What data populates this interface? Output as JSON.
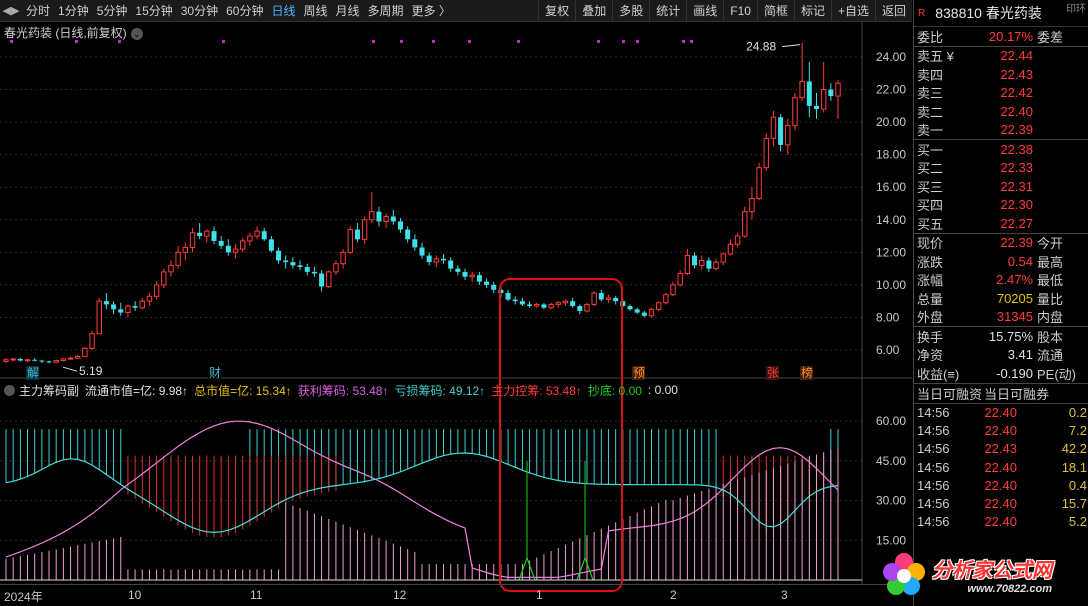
{
  "toolbar": {
    "periods": [
      "分时",
      "1分钟",
      "5分钟",
      "15分钟",
      "30分钟",
      "60分钟",
      "日线",
      "周线",
      "月线",
      "多周期",
      "更多 〉"
    ],
    "active_period": "日线",
    "right_items": [
      "复权",
      "叠加",
      "多股",
      "统计",
      "画线",
      "F10",
      "简框",
      "标记",
      "+自选",
      "返回"
    ]
  },
  "chart": {
    "title": "春光药装 (日线,前复权)",
    "y_labels": [
      "24.00",
      "22.00",
      "20.00",
      "18.00",
      "16.00",
      "14.00",
      "12.00",
      "10.00",
      "8.00",
      "6.00"
    ],
    "high_label": "24.88",
    "low_label": "5.19",
    "event_tags": [
      {
        "text": "解",
        "color": "#3fb8d0",
        "bg": "#0d3040"
      },
      {
        "text": "财",
        "color": "#3fb8d0",
        "bg": "#000"
      },
      {
        "text": "预",
        "color": "#ff9020",
        "bg": "#402010"
      },
      {
        "text": "张",
        "color": "#ff3b3b",
        "bg": "#401010"
      },
      {
        "text": "榜",
        "color": "#ff9020",
        "bg": "#402010"
      }
    ]
  },
  "chart_data": {
    "type": "candlestick",
    "y_axis": [
      6.0,
      24.0
    ],
    "x_months": [
      "2024年",
      "10",
      "11",
      "12",
      "1",
      "2",
      "3"
    ],
    "ohlc": [
      [
        5.3,
        5.5,
        5.2,
        5.4
      ],
      [
        5.4,
        5.5,
        5.3,
        5.45
      ],
      [
        5.45,
        5.5,
        5.3,
        5.35
      ],
      [
        5.35,
        5.45,
        5.25,
        5.4
      ],
      [
        5.4,
        5.5,
        5.3,
        5.35
      ],
      [
        5.35,
        5.4,
        5.2,
        5.3
      ],
      [
        5.3,
        5.35,
        5.19,
        5.25
      ],
      [
        5.25,
        5.4,
        5.2,
        5.35
      ],
      [
        5.35,
        5.5,
        5.3,
        5.45
      ],
      [
        5.45,
        5.6,
        5.4,
        5.5
      ],
      [
        5.5,
        5.7,
        5.45,
        5.6
      ],
      [
        5.6,
        6.2,
        5.6,
        6.1
      ],
      [
        6.1,
        7.2,
        6.0,
        7.0
      ],
      [
        7.0,
        9.2,
        7.0,
        9.0
      ],
      [
        9.0,
        9.5,
        8.5,
        8.8
      ],
      [
        8.8,
        9.0,
        8.2,
        8.5
      ],
      [
        8.5,
        8.9,
        8.1,
        8.3
      ],
      [
        8.3,
        8.8,
        8.0,
        8.7
      ],
      [
        8.7,
        9.0,
        8.4,
        8.6
      ],
      [
        8.6,
        9.2,
        8.5,
        9.0
      ],
      [
        9.0,
        9.5,
        8.7,
        9.3
      ],
      [
        9.3,
        10.2,
        9.1,
        10.0
      ],
      [
        10.0,
        11.0,
        9.8,
        10.8
      ],
      [
        10.8,
        11.5,
        10.5,
        11.2
      ],
      [
        11.2,
        12.4,
        11.0,
        12.0
      ],
      [
        12.0,
        12.6,
        11.5,
        12.3
      ],
      [
        12.3,
        13.5,
        12.0,
        13.2
      ],
      [
        13.2,
        13.8,
        12.8,
        13.0
      ],
      [
        13.0,
        13.4,
        12.6,
        13.3
      ],
      [
        13.3,
        13.6,
        12.5,
        12.7
      ],
      [
        12.7,
        13.0,
        12.2,
        12.4
      ],
      [
        12.4,
        12.8,
        11.8,
        12.0
      ],
      [
        12.0,
        12.5,
        11.6,
        12.2
      ],
      [
        12.2,
        12.9,
        12.0,
        12.7
      ],
      [
        12.7,
        13.2,
        12.4,
        13.0
      ],
      [
        13.0,
        13.6,
        12.8,
        13.3
      ],
      [
        13.3,
        13.5,
        12.7,
        12.8
      ],
      [
        12.8,
        13.0,
        12.0,
        12.1
      ],
      [
        12.1,
        12.3,
        11.3,
        11.5
      ],
      [
        11.5,
        11.8,
        11.0,
        11.4
      ],
      [
        11.4,
        11.7,
        11.0,
        11.2
      ],
      [
        11.2,
        11.5,
        10.9,
        11.1
      ],
      [
        11.1,
        11.3,
        10.6,
        10.8
      ],
      [
        10.8,
        11.1,
        10.5,
        10.7
      ],
      [
        10.7,
        10.9,
        9.6,
        9.9
      ],
      [
        9.9,
        10.9,
        9.8,
        10.8
      ],
      [
        10.8,
        11.5,
        10.6,
        11.3
      ],
      [
        11.3,
        12.2,
        11.0,
        12.0
      ],
      [
        12.0,
        13.6,
        11.9,
        13.4
      ],
      [
        13.4,
        13.8,
        12.6,
        12.8
      ],
      [
        12.8,
        14.2,
        12.5,
        14.0
      ],
      [
        14.0,
        15.7,
        13.8,
        14.5
      ],
      [
        14.5,
        14.8,
        13.6,
        13.9
      ],
      [
        13.9,
        14.4,
        13.5,
        14.2
      ],
      [
        14.2,
        14.6,
        13.7,
        13.9
      ],
      [
        13.9,
        14.1,
        13.2,
        13.4
      ],
      [
        13.4,
        13.6,
        12.6,
        12.8
      ],
      [
        12.8,
        13.1,
        12.1,
        12.3
      ],
      [
        12.3,
        12.6,
        11.6,
        11.8
      ],
      [
        11.8,
        12.0,
        11.2,
        11.4
      ],
      [
        11.4,
        11.8,
        11.1,
        11.6
      ],
      [
        11.6,
        11.9,
        11.3,
        11.5
      ],
      [
        11.5,
        11.7,
        10.8,
        11.0
      ],
      [
        11.0,
        11.2,
        10.6,
        10.8
      ],
      [
        10.8,
        11.0,
        10.3,
        10.5
      ],
      [
        10.5,
        10.8,
        10.2,
        10.6
      ],
      [
        10.6,
        10.8,
        10.0,
        10.2
      ],
      [
        10.2,
        10.4,
        9.8,
        10.0
      ],
      [
        10.0,
        10.2,
        9.5,
        9.7
      ],
      [
        9.7,
        9.9,
        9.2,
        9.5
      ],
      [
        9.5,
        9.7,
        9.0,
        9.1
      ],
      [
        9.1,
        9.3,
        8.8,
        9.0
      ],
      [
        9.0,
        9.2,
        8.7,
        8.8
      ],
      [
        8.8,
        9.0,
        8.6,
        8.7
      ],
      [
        8.7,
        8.9,
        8.6,
        8.8
      ],
      [
        8.8,
        8.9,
        8.5,
        8.6
      ],
      [
        8.6,
        8.9,
        8.5,
        8.8
      ],
      [
        8.8,
        9.0,
        8.6,
        8.9
      ],
      [
        8.9,
        9.1,
        8.7,
        9.0
      ],
      [
        9.0,
        9.2,
        8.6,
        8.7
      ],
      [
        8.7,
        8.8,
        8.2,
        8.4
      ],
      [
        8.4,
        8.9,
        8.3,
        8.8
      ],
      [
        8.8,
        9.6,
        8.7,
        9.5
      ],
      [
        9.5,
        9.7,
        9.0,
        9.1
      ],
      [
        9.1,
        9.4,
        8.9,
        9.2
      ],
      [
        9.2,
        9.3,
        8.8,
        9.0
      ],
      [
        9.0,
        9.1,
        8.6,
        8.7
      ],
      [
        8.7,
        8.8,
        8.4,
        8.5
      ],
      [
        8.5,
        8.6,
        8.2,
        8.3
      ],
      [
        8.3,
        8.4,
        8.0,
        8.1
      ],
      [
        8.1,
        8.6,
        8.0,
        8.5
      ],
      [
        8.5,
        9.0,
        8.4,
        8.9
      ],
      [
        8.9,
        9.5,
        8.8,
        9.4
      ],
      [
        9.4,
        10.2,
        9.3,
        10.0
      ],
      [
        10.0,
        10.9,
        9.9,
        10.7
      ],
      [
        10.7,
        12.2,
        10.6,
        11.8
      ],
      [
        11.8,
        12.0,
        11.0,
        11.2
      ],
      [
        11.2,
        11.8,
        10.9,
        11.5
      ],
      [
        11.5,
        11.7,
        10.8,
        11.0
      ],
      [
        11.0,
        11.6,
        10.9,
        11.4
      ],
      [
        11.4,
        12.0,
        11.2,
        11.9
      ],
      [
        11.9,
        12.8,
        11.8,
        12.5
      ],
      [
        12.5,
        13.2,
        12.3,
        13.0
      ],
      [
        13.0,
        14.8,
        12.9,
        14.5
      ],
      [
        14.5,
        16.0,
        14.0,
        15.3
      ],
      [
        15.3,
        17.5,
        15.2,
        17.2
      ],
      [
        17.2,
        19.3,
        17.0,
        19.0
      ],
      [
        19.0,
        20.7,
        18.5,
        20.3
      ],
      [
        20.3,
        20.5,
        18.2,
        18.6
      ],
      [
        18.6,
        20.2,
        18.0,
        19.8
      ],
      [
        19.8,
        21.8,
        19.5,
        21.5
      ],
      [
        21.5,
        24.88,
        21.3,
        22.5
      ],
      [
        22.5,
        23.7,
        20.3,
        21.0
      ],
      [
        21.0,
        21.8,
        20.2,
        20.8
      ],
      [
        20.8,
        23.7,
        20.6,
        22.0
      ],
      [
        22.0,
        22.4,
        21.3,
        21.6
      ],
      [
        21.6,
        22.6,
        20.2,
        22.39
      ]
    ],
    "indicator": {
      "name": "主力筹码副",
      "fields": [
        {
          "label": "流通市值=亿:",
          "value": "9.98↑",
          "color": "#e0e0e0"
        },
        {
          "label": "总市值=亿:",
          "value": "15.34↑",
          "color": "#e8c000"
        },
        {
          "label": "获利筹码:",
          "value": "53.48↑",
          "color": "#e060e0"
        },
        {
          "label": "亏损筹码:",
          "value": "49.12↑",
          "color": "#40d0d0"
        },
        {
          "label": "主力控筹:",
          "value": "53.48↑",
          "color": "#ff3b3b"
        },
        {
          "label": "抄底:",
          "value": "0.00",
          "color": "#18d018"
        },
        {
          "label": ":",
          "value": "0.00",
          "color": "#e0e0e0"
        }
      ],
      "y_labels": [
        "60.00",
        "45.00",
        "30.00",
        "15.00"
      ],
      "y_axis": [
        0,
        68
      ]
    }
  },
  "panel": {
    "code": "838810 春光药装",
    "r_badge": "R",
    "corner": "印环",
    "weibi": {
      "label": "委比",
      "value": "20.17%",
      "label2": "委差"
    },
    "asks": [
      {
        "label": "卖五 ¥",
        "price": "22.44"
      },
      {
        "label": "卖四",
        "price": "22.43"
      },
      {
        "label": "卖三",
        "price": "22.42"
      },
      {
        "label": "卖二",
        "price": "22.40"
      },
      {
        "label": "卖一",
        "price": "22.39"
      }
    ],
    "bids": [
      {
        "label": "买一",
        "price": "22.38"
      },
      {
        "label": "买二",
        "price": "22.33"
      },
      {
        "label": "买三",
        "price": "22.31"
      },
      {
        "label": "买四",
        "price": "22.30"
      },
      {
        "label": "买五",
        "price": "22.27"
      }
    ],
    "stats": [
      {
        "label": "现价",
        "value": "22.39",
        "label2": "今开",
        "cls": "red"
      },
      {
        "label": "涨跌",
        "value": "0.54",
        "label2": "最高",
        "cls": "red"
      },
      {
        "label": "涨幅",
        "value": "2.47%",
        "label2": "最低",
        "cls": "red"
      },
      {
        "label": "总量",
        "value": "70205",
        "label2": "量比",
        "cls": "yellow"
      },
      {
        "label": "外盘",
        "value": "31345",
        "label2": "内盘",
        "cls": "red"
      }
    ],
    "stats2": [
      {
        "label": "换手",
        "value": "15.75%",
        "label2": "股本",
        "cls": "white"
      },
      {
        "label": "净资",
        "value": "3.41",
        "label2": "流通",
        "cls": "white"
      },
      {
        "label": "收益(≡)",
        "value": "-0.190",
        "label2": "PE(动)",
        "cls": "white"
      }
    ],
    "margin": {
      "label1": "当日可融资",
      "label2": "当日可融券"
    },
    "ticks": [
      {
        "time": "14:56",
        "price": "22.40",
        "qty": "0.2"
      },
      {
        "time": "14:56",
        "price": "22.40",
        "qty": "7.2"
      },
      {
        "time": "14:56",
        "price": "22.43",
        "qty": "42.2"
      },
      {
        "time": "14:56",
        "price": "22.40",
        "qty": "18.1"
      },
      {
        "time": "14:56",
        "price": "22.40",
        "qty": "0.4"
      },
      {
        "time": "14:56",
        "price": "22.40",
        "qty": "15.7"
      },
      {
        "time": "14:56",
        "price": "22.40",
        "qty": "5.2"
      }
    ]
  },
  "logo": {
    "cn": "分析家公式网",
    "url": "www.70822.com"
  }
}
